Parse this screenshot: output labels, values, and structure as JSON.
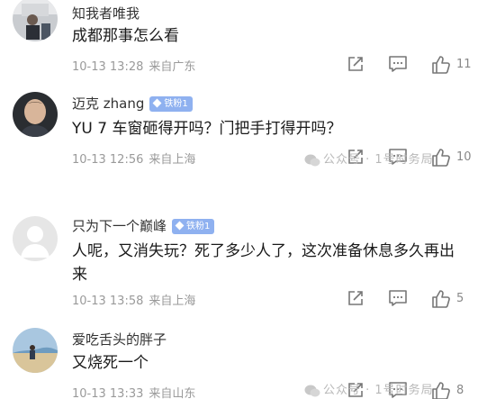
{
  "comments": [
    {
      "user": "知我者唯我",
      "badge": "",
      "text": "成都那事怎么看",
      "time": "10-13 13:28",
      "location": "来自广东",
      "likes": "11",
      "avatar": "photo-avatar"
    },
    {
      "user": "迈克 zhang",
      "badge": "铁粉1",
      "text": "YU 7 车窗砸得开吗？门把手打得开吗？",
      "time": "10-13 12:56",
      "location": "来自上海",
      "likes": "10",
      "avatar": "photo-avatar"
    },
    {
      "user": "只为下一个巅峰",
      "badge": "铁粉1",
      "text": "人呢，又消失玩？死了多少人了，这次准备休息多久再出来",
      "time": "10-13 13:58",
      "location": "来自上海",
      "likes": "5",
      "avatar": "default-avatar"
    },
    {
      "user": "爱吃舌头的胖子",
      "badge": "",
      "text": "又烧死一个",
      "time": "10-13 13:33",
      "location": "来自山东",
      "likes": "8",
      "avatar": "photo-avatar"
    }
  ],
  "watermark": {
    "text1": "公众号 · 1号时务局",
    "text2": "公众号 · 1号时务局"
  },
  "colors": {
    "badge": "#8fb1f0",
    "meta": "#9a9a9a",
    "text": "#1a1a1a"
  }
}
